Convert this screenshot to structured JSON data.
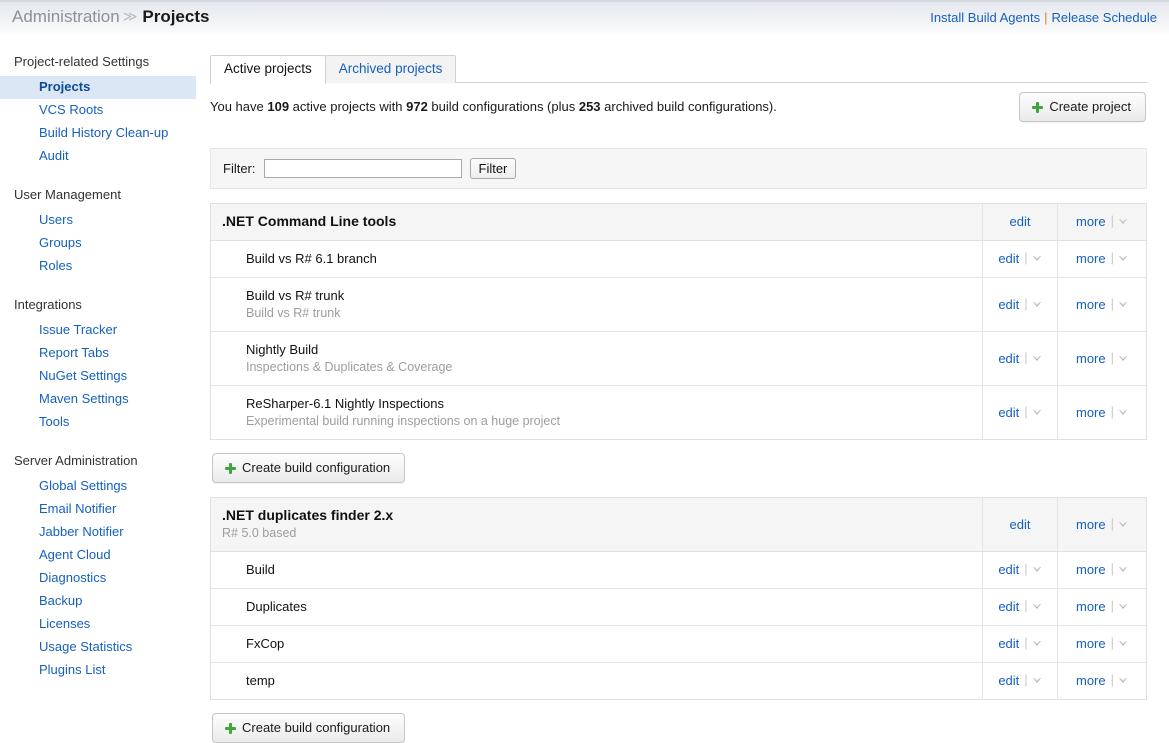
{
  "topbar": {
    "breadcrumb_parent": "Administration",
    "breadcrumb_separator": "≫",
    "breadcrumb_current": "Projects",
    "link_install_agents": "Install Build Agents",
    "link_divider": "|",
    "link_release_schedule": "Release Schedule"
  },
  "sidebar": {
    "groups": [
      {
        "title": "Project-related Settings",
        "items": [
          {
            "label": "Projects",
            "active": true
          },
          {
            "label": "VCS Roots",
            "active": false
          },
          {
            "label": "Build History Clean-up",
            "active": false
          },
          {
            "label": "Audit",
            "active": false
          }
        ]
      },
      {
        "title": "User Management",
        "items": [
          {
            "label": "Users",
            "active": false
          },
          {
            "label": "Groups",
            "active": false
          },
          {
            "label": "Roles",
            "active": false
          }
        ]
      },
      {
        "title": "Integrations",
        "items": [
          {
            "label": "Issue Tracker",
            "active": false
          },
          {
            "label": "Report Tabs",
            "active": false
          },
          {
            "label": "NuGet Settings",
            "active": false
          },
          {
            "label": "Maven Settings",
            "active": false
          },
          {
            "label": "Tools",
            "active": false
          }
        ]
      },
      {
        "title": "Server Administration",
        "items": [
          {
            "label": "Global Settings",
            "active": false
          },
          {
            "label": "Email Notifier",
            "active": false
          },
          {
            "label": "Jabber Notifier",
            "active": false
          },
          {
            "label": "Agent Cloud",
            "active": false
          },
          {
            "label": "Diagnostics",
            "active": false
          },
          {
            "label": "Backup",
            "active": false
          },
          {
            "label": "Licenses",
            "active": false
          },
          {
            "label": "Usage Statistics",
            "active": false
          },
          {
            "label": "Plugins List",
            "active": false
          }
        ]
      }
    ]
  },
  "tabs": [
    {
      "label": "Active projects",
      "active": true
    },
    {
      "label": "Archived projects",
      "active": false
    }
  ],
  "summary": {
    "prefix": "You have ",
    "active_projects_count": "109",
    "mid1": " active projects with ",
    "build_configurations_count": "972",
    "mid2": " build configurations (plus ",
    "archived_build_configurations_count": "253",
    "suffix": " archived build configurations)."
  },
  "create_project_button": "Create project",
  "filter": {
    "label": "Filter:",
    "value": "",
    "placeholder": "",
    "button": "Filter"
  },
  "actions": {
    "edit": "edit",
    "more": "more"
  },
  "create_build_configuration_button": "Create build configuration",
  "projects": [
    {
      "name": ".NET Command Line tools",
      "description": "",
      "configs": [
        {
          "name": "Build vs R# 6.1 branch",
          "description": ""
        },
        {
          "name": "Build vs R# trunk",
          "description": "Build vs R# trunk"
        },
        {
          "name": "Nightly Build",
          "description": "Inspections & Duplicates & Coverage"
        },
        {
          "name": "ReSharper-6.1 Nightly Inspections",
          "description": "Experimental build running inspections on a huge project"
        }
      ]
    },
    {
      "name": ".NET duplicates finder 2.x",
      "description": "R# 5.0 based",
      "configs": [
        {
          "name": "Build",
          "description": ""
        },
        {
          "name": "Duplicates",
          "description": ""
        },
        {
          "name": "FxCop",
          "description": ""
        },
        {
          "name": "temp",
          "description": ""
        }
      ]
    }
  ],
  "colors": {
    "link": "#1560bd",
    "active_nav_bg": "#dbe7f4",
    "muted_text": "#9d9d9d",
    "plus_green": "#3fa63f",
    "divider_orange": "#c98a3a"
  }
}
